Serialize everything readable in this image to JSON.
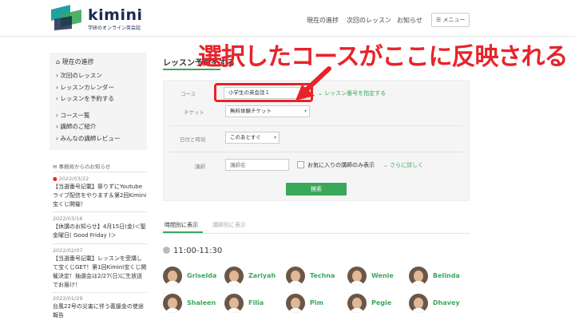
{
  "header": {
    "logo_text": "kimini",
    "logo_sub": "学研のオンライン英会話",
    "nav": [
      "現在の進捗",
      "次回のレッスン",
      "お知らせ"
    ],
    "menu_label": "メニュー"
  },
  "sidebar": {
    "title": "現在の進捗",
    "group1": [
      "次回のレッスン",
      "レッスンカレンダー",
      "レッスンを予約する"
    ],
    "group2": [
      "コース一覧",
      "講師のご紹介",
      "みんなの講師レビュー"
    ]
  },
  "news": {
    "heading": "事務局からのお知らせ",
    "items": [
      {
        "date": "2022/03/22",
        "body": "【当選番号記載】祭りずにYoutubeライブ配信をやります＆第2回Kimini宝くじ開催！"
      },
      {
        "date": "2022/03/16",
        "body": "【休講のお知らせ】4月15日(金)＜聖金曜日( Good Friday )＞"
      },
      {
        "date": "2022/02/07",
        "body": "【当選番号記載】レッスンを受講して宝くじGET！第1回Kimini宝くじ開催決定！抽選会は2/27(日)に生放送でお届け！"
      },
      {
        "date": "2022/01/29",
        "body": "台風22号の災害に伴う義援金の使途報告"
      }
    ]
  },
  "main": {
    "title": "レッスン予約をする",
    "form": {
      "course_label": "コース",
      "course_value": "小学生の英会話１",
      "lesson_number_link": "レッスン番号を指定する",
      "ticket_label": "チケット",
      "ticket_value": "無料体験チケット",
      "date_label": "日付と時刻",
      "date_value": "このあとすぐ",
      "teacher_label": "講師",
      "teacher_placeholder": "講師名",
      "favorite_label": "お気に入りの講師のみ表示",
      "more_link": "さらに詳しく",
      "search_button": "検索"
    },
    "tabs": [
      "時間別に表示",
      "講師別に表示"
    ],
    "time_slot": "11:00-11:30",
    "teachers": [
      "Griselda",
      "Zariyah",
      "Techna",
      "Wenie",
      "Belinda",
      "Shaleen",
      "Filia",
      "Pim",
      "Pegie",
      "Dhavey"
    ]
  },
  "annotation": "選択したコースがここに反映される",
  "colors": {
    "accent": "#3aa85a",
    "annotation": "#e8232a",
    "logo_navy": "#1b2a4e",
    "logo_teal": "#1fa3a0"
  }
}
